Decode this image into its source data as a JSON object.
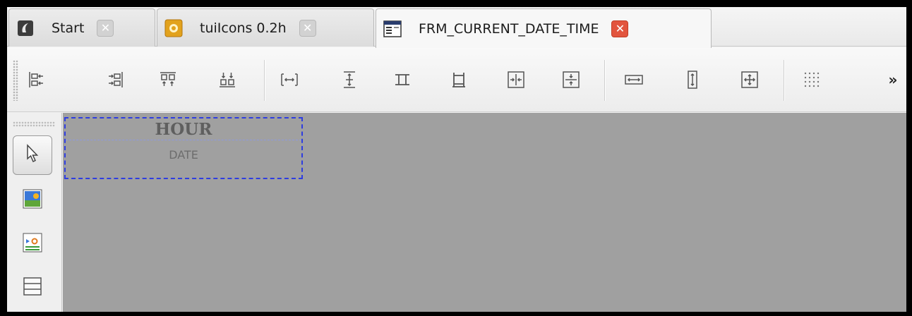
{
  "tabs": [
    {
      "label": "Start",
      "icon": "app-icon",
      "active": false
    },
    {
      "label": "tuiIcons 0.2h",
      "icon": "icon-pack-icon",
      "active": false
    },
    {
      "label": "FRM_CURRENT_DATE_TIME",
      "icon": "form-icon",
      "active": true
    }
  ],
  "toolbar": {
    "buttons": [
      "align-left-icon",
      "align-right-icon",
      "align-top-icon",
      "align-bottom-icon",
      "distribute-horizontal-icon",
      "distribute-vertical-icon",
      "same-width-icon",
      "same-height-icon",
      "center-horizontal-icon",
      "center-vertical-icon",
      "stretch-horizontal-icon",
      "stretch-vertical-icon",
      "stretch-both-icon",
      "grid-icon"
    ],
    "more": "»"
  },
  "palette": {
    "tools": [
      "pointer-icon",
      "image-widget-icon",
      "slider-widget-icon",
      "panel-widget-icon"
    ]
  },
  "canvas": {
    "widget_label_hour": "HOUR",
    "widget_label_date": "DATE",
    "background": "#a0a0a0",
    "selection_color": "#2e3de0"
  }
}
